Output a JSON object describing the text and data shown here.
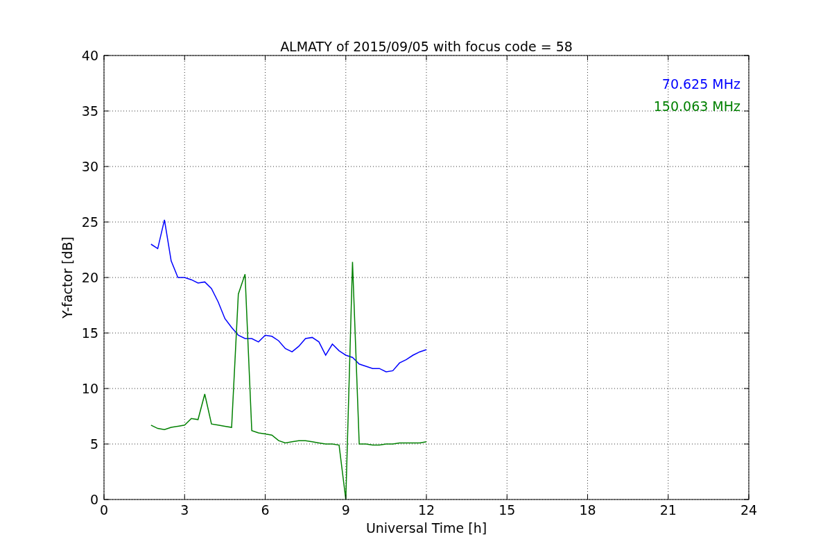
{
  "chart_data": {
    "type": "line",
    "title": "ALMATY of 2015/09/05 with focus code = 58",
    "xlabel": "Universal Time [h]",
    "ylabel": "Y-factor [dB]",
    "x": [
      1.75,
      2.0,
      2.25,
      2.5,
      2.75,
      3.0,
      3.25,
      3.5,
      3.75,
      4.0,
      4.25,
      4.5,
      4.75,
      5.0,
      5.25,
      5.5,
      5.75,
      6.0,
      6.25,
      6.5,
      6.75,
      7.0,
      7.25,
      7.5,
      7.75,
      8.0,
      8.25,
      8.5,
      8.75,
      9.0,
      9.25,
      9.5,
      9.75,
      10.0,
      10.25,
      10.5,
      10.75,
      11.0,
      11.25,
      11.5,
      11.75,
      12.0
    ],
    "series": [
      {
        "name": "70.625 MHz",
        "color": "#0000ff",
        "values": [
          23.0,
          22.6,
          25.2,
          21.5,
          20.0,
          20.0,
          19.8,
          19.5,
          19.6,
          19.0,
          17.8,
          16.3,
          15.5,
          14.8,
          14.5,
          14.5,
          14.2,
          14.8,
          14.7,
          14.3,
          13.6,
          13.3,
          13.8,
          14.5,
          14.6,
          14.2,
          13.0,
          14.0,
          13.4,
          13.0,
          12.8,
          12.2,
          12.0,
          11.8,
          11.8,
          11.5,
          11.6,
          12.3,
          12.6,
          13.0,
          13.3,
          13.5
        ]
      },
      {
        "name": "150.063 MHz",
        "color": "#008000",
        "values": [
          6.7,
          6.4,
          6.3,
          6.5,
          6.6,
          6.7,
          7.3,
          7.2,
          9.5,
          6.8,
          6.7,
          6.6,
          6.5,
          18.5,
          20.3,
          6.2,
          6.0,
          5.9,
          5.8,
          5.3,
          5.1,
          5.2,
          5.3,
          5.3,
          5.2,
          5.1,
          5.0,
          5.0,
          4.9,
          0,
          21.4,
          5.0,
          5.0,
          4.9,
          4.9,
          5.0,
          5.0,
          5.1,
          5.1,
          5.1,
          5.1,
          5.2
        ]
      }
    ],
    "xlim": [
      0,
      24
    ],
    "ylim": [
      0,
      40
    ],
    "xticks": [
      0,
      3,
      6,
      9,
      12,
      15,
      18,
      21,
      24
    ],
    "yticks": [
      0,
      5,
      10,
      15,
      20,
      25,
      30,
      35,
      40
    ],
    "grid": true
  }
}
